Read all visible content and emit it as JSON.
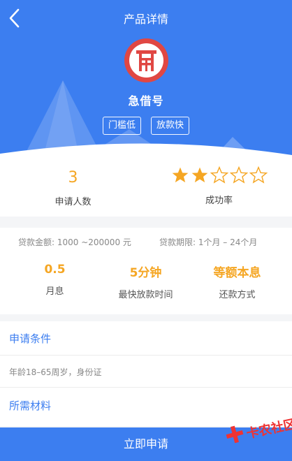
{
  "header": {
    "title": "产品详情"
  },
  "product": {
    "name": "急借号",
    "tags": [
      "门槛低",
      "放款快"
    ]
  },
  "stats": {
    "applicants_value": "3",
    "applicants_label": "申请人数",
    "success_label": "成功率",
    "success_stars": 2,
    "success_stars_total": 5
  },
  "loan": {
    "amount_label": "贷款金额: 1000 ~200000 元",
    "term_label": "贷款期限: 1个月 – 24个月",
    "metrics": [
      {
        "value": "0.5",
        "label": "月息"
      },
      {
        "value": "5分钟",
        "label": "最快放款时间"
      },
      {
        "value": "等额本息",
        "label": "还款方式"
      }
    ]
  },
  "conditions": {
    "title": "申请条件",
    "text": "年龄18–65周岁，身份证"
  },
  "materials": {
    "title": "所需材料"
  },
  "footer": {
    "apply_label": "立即申请"
  },
  "watermark": {
    "text": "卡农社区"
  },
  "colors": {
    "primary": "#3c7ef0",
    "accent": "#f5a623",
    "logo": "#e04743"
  }
}
